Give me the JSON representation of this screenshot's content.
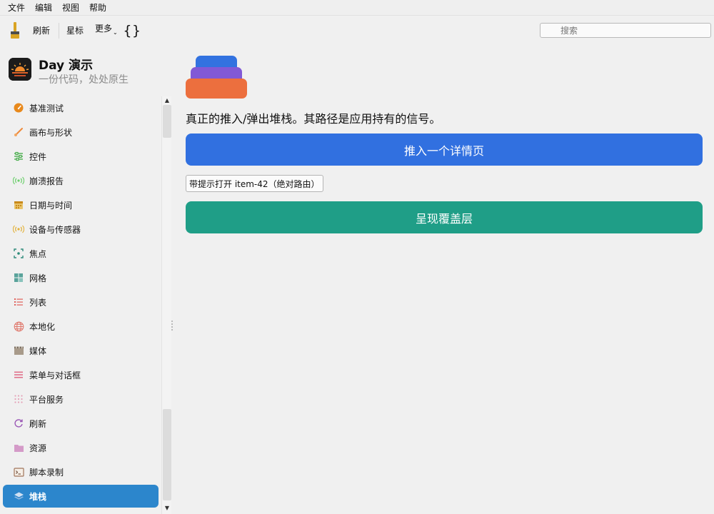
{
  "menubar": {
    "items": [
      "文件",
      "编辑",
      "视图",
      "帮助"
    ]
  },
  "toolbar": {
    "refresh_label": "刷新",
    "star_label": "星标",
    "more_label": "更多",
    "braces_label": "{}",
    "search_placeholder": "搜索"
  },
  "app": {
    "title": "Day 演示",
    "subtitle": "一份代码，处处原生"
  },
  "sidebar": {
    "items": [
      {
        "label": "基准测试",
        "icon": "speedometer-icon",
        "color": "#e8891c"
      },
      {
        "label": "画布与形状",
        "icon": "brush-icon",
        "color": "#ef8a3a"
      },
      {
        "label": "控件",
        "icon": "sliders-icon",
        "color": "#4caf50"
      },
      {
        "label": "崩溃报告",
        "icon": "broadcast-icon",
        "color": "#6ccf6c"
      },
      {
        "label": "日期与时间",
        "icon": "calendar-icon",
        "color": "#c98a1b"
      },
      {
        "label": "设备与传感器",
        "icon": "sensor-icon",
        "color": "#e3b23c"
      },
      {
        "label": "焦点",
        "icon": "focus-icon",
        "color": "#2e8b7a"
      },
      {
        "label": "网格",
        "icon": "grid-icon",
        "color": "#5aa39b"
      },
      {
        "label": "列表",
        "icon": "list-icon",
        "color": "#e0605a"
      },
      {
        "label": "本地化",
        "icon": "globe-icon",
        "color": "#e07a6e"
      },
      {
        "label": "媒体",
        "icon": "clapper-icon",
        "color": "#a89a8a"
      },
      {
        "label": "菜单与对话框",
        "icon": "menu-icon",
        "color": "#e0708a"
      },
      {
        "label": "平台服务",
        "icon": "dots-grid-icon",
        "color": "#e4a3b8"
      },
      {
        "label": "刷新",
        "icon": "refresh-icon",
        "color": "#9b59b6"
      },
      {
        "label": "资源",
        "icon": "folder-icon",
        "color": "#d49ac8"
      },
      {
        "label": "脚本录制",
        "icon": "terminal-icon",
        "color": "#a0745a"
      },
      {
        "label": "堆栈",
        "icon": "layers-icon",
        "color": "#cfe0f2",
        "active": true
      }
    ]
  },
  "main": {
    "stack_colors": [
      "#3272e0",
      "#8159d6",
      "#ec6f3e"
    ],
    "description": "真正的推入/弹出堆栈。其路径是应用持有的信号。",
    "push_button_label": "推入一个详情页",
    "hint_button_label": "带提示打开 item-42（绝对路由）",
    "overlay_button_label": "呈现覆盖层",
    "push_color": "#3170e0",
    "overlay_color": "#1f9e87"
  }
}
